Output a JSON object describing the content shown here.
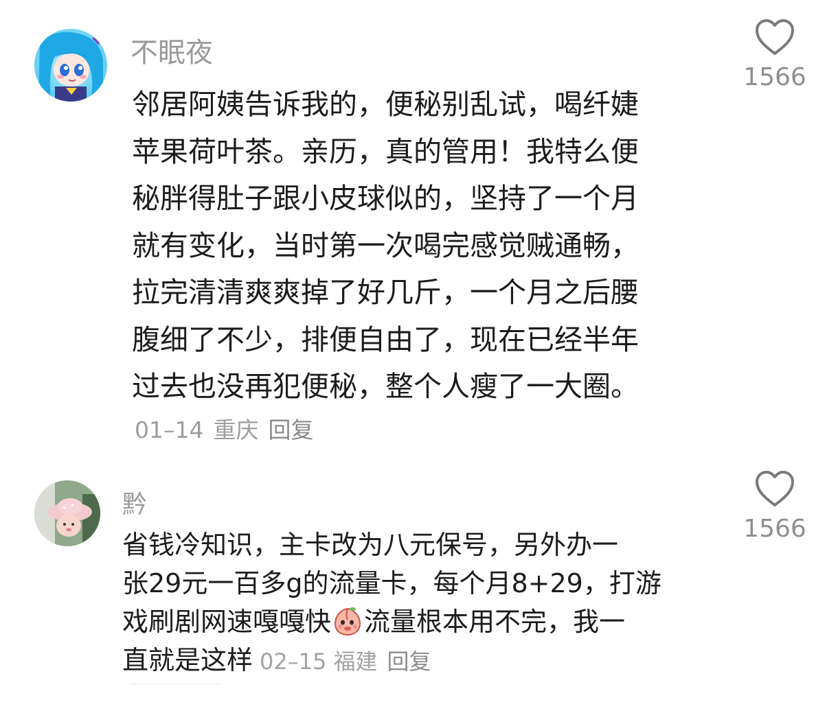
{
  "comments": [
    {
      "author": "不眠夜",
      "lines": [
        "邻居阿姨告诉我的，便秘别乱试，喝纤婕",
        "苹果荷叶茶。亲历，真的管用！我特么便",
        "秘胖得肚子跟小皮球似的，坚持了一个月",
        "就有变化，当时第一次喝完感觉贼通畅，",
        "拉完清清爽爽掉了好几斤，一个月之后腰",
        "腹细了不少，排便自由了，现在已经半年",
        "过去也没再犯便秘，整个人瘦了一大圈。"
      ],
      "date": "01–14",
      "location": "重庆",
      "reply_label": "回复",
      "likes": "1566",
      "avatar_icon": "anime-girl-avatar"
    },
    {
      "author": "黔",
      "lines": [
        "省钱冷知识，主卡改为八元保号，另外办一",
        "张29元一百多g的流量卡，每个月8+29，打游"
      ],
      "line3_before_emoji": "戏刷剧网速嘎嘎快",
      "emoji_icon": "peach-face-emoji",
      "line3_after_emoji": "流量根本用不完，我一",
      "line4_text": "直就是这样",
      "date": "02–15",
      "location": "福建",
      "reply_label": "回复",
      "likes": "1566",
      "avatar_icon": "pink-hat-pet-avatar"
    }
  ],
  "colors": {
    "author": "#9a9a9a",
    "body": "#1c1c1c",
    "meta": "#9e9e9e",
    "heart_outline": "#7a7a7a"
  }
}
